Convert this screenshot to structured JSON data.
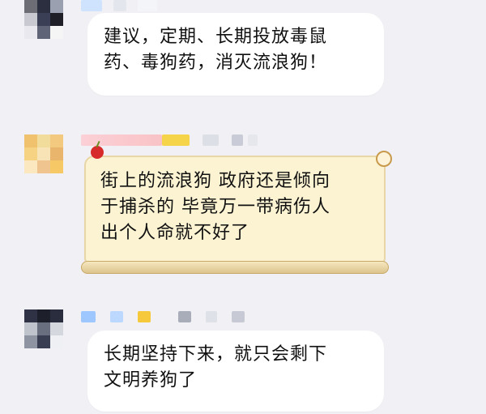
{
  "messages": [
    {
      "lines": [
        "建议，定期、长期投放毒鼠",
        "药、毒狗药，消灭流浪狗！"
      ],
      "style": "plain"
    },
    {
      "lines": [
        "街上的流浪狗 政府还是倾向",
        "于捕杀的 毕竟万一带病伤人",
        "出个人命就不好了"
      ],
      "style": "decorated"
    },
    {
      "lines": [
        "长期坚持下来，就只会剩下",
        "文明养狗了"
      ],
      "style": "plain"
    }
  ],
  "colors": {
    "background": "#f1f1f5",
    "bubble": "#ffffff",
    "decorated_bubble": "#fbf3d2"
  },
  "icons": [
    "pixelated-avatar-icon",
    "cherry-icon"
  ]
}
